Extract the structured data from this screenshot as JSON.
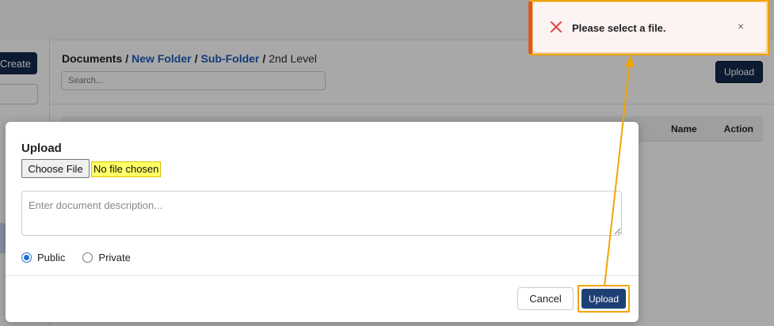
{
  "background": {
    "create_label": "Create",
    "breadcrumb": {
      "root": "Documents",
      "sep": "/",
      "folder1": "New Folder",
      "folder2": "Sub-Folder",
      "current": "2nd Level"
    },
    "search_placeholder": "Search...",
    "upload_label": "Upload",
    "table": {
      "name_header": "Name",
      "action_header": "Action"
    }
  },
  "modal": {
    "title": "Upload",
    "choose_file_label": "Choose File",
    "no_file_text": "No file chosen",
    "description_placeholder": "Enter document description...",
    "visibility": {
      "options": [
        {
          "label": "Public",
          "checked": true
        },
        {
          "label": "Private",
          "checked": false
        }
      ]
    },
    "cancel_label": "Cancel",
    "upload_label": "Upload"
  },
  "toast": {
    "message": "Please select a file.",
    "close_symbol": "×",
    "icon": "error-x-icon",
    "type": "error"
  },
  "colors": {
    "navy_button": "#13294b",
    "modal_upload_button": "#1d3f73",
    "link": "#1f5bb8",
    "error": "#e24b4b",
    "annotation": "#f0a500",
    "file_highlight": "#ffff66"
  }
}
